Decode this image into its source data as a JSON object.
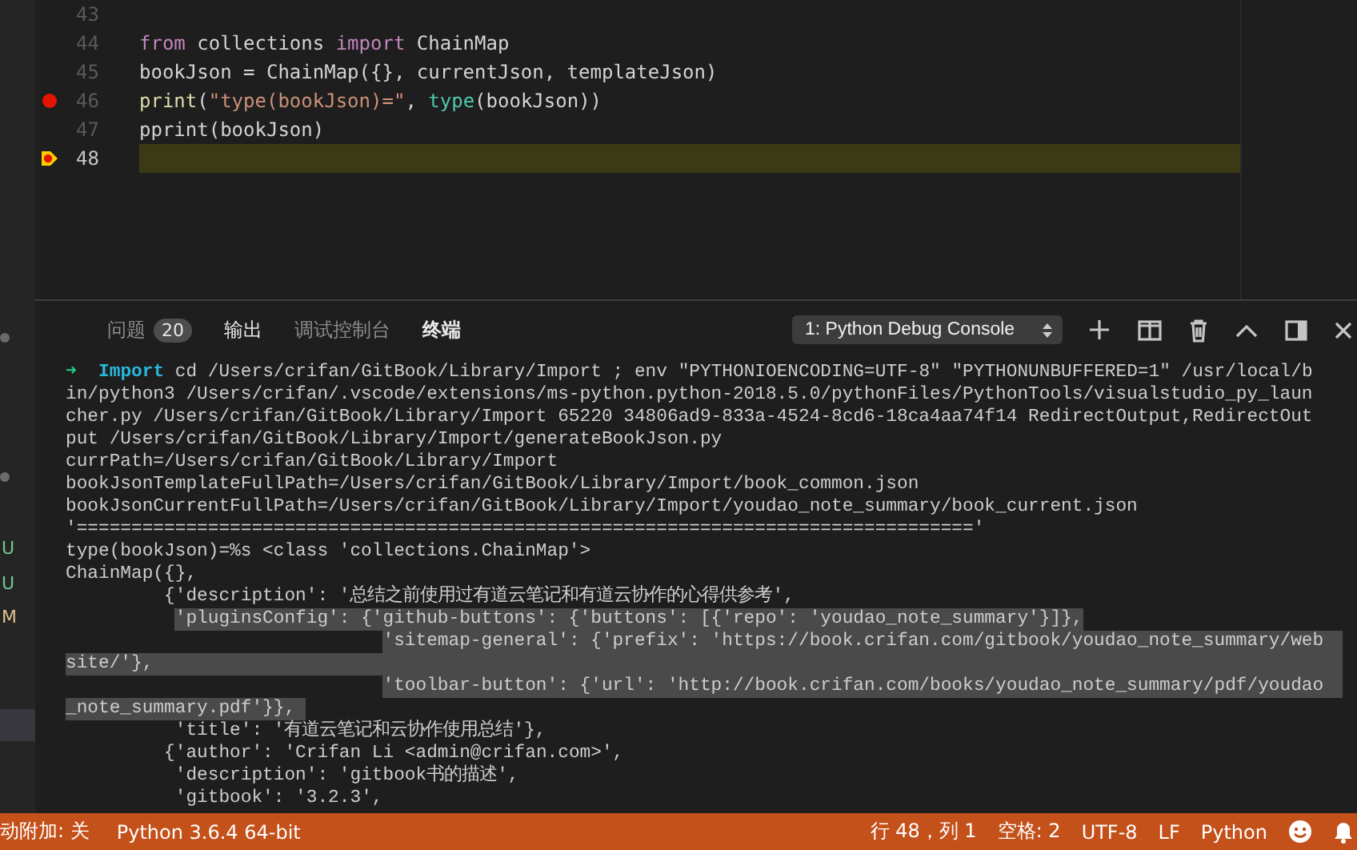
{
  "left_strip": {
    "items": [
      {
        "text": "U",
        "color": "#73c991"
      },
      {
        "text": "U",
        "color": "#73c991"
      },
      {
        "text": "M",
        "color": "#e2c08d"
      }
    ]
  },
  "editor": {
    "lines": [
      {
        "number": "43",
        "breakpoint": false,
        "paused": false,
        "current": false
      },
      {
        "number": "44",
        "breakpoint": false,
        "paused": false,
        "current": false,
        "tokens": [
          {
            "text": "from",
            "kind": "keyword"
          },
          {
            "text": " collections ",
            "kind": "plain"
          },
          {
            "text": "import",
            "kind": "keyword"
          },
          {
            "text": " ChainMap",
            "kind": "plain"
          }
        ]
      },
      {
        "number": "45",
        "breakpoint": false,
        "paused": false,
        "current": false,
        "tokens": [
          {
            "text": "bookJson = ChainMap({}, currentJson, templateJson)",
            "kind": "plain"
          }
        ]
      },
      {
        "number": "46",
        "breakpoint": true,
        "paused": false,
        "current": false,
        "tokens": [
          {
            "text": "print",
            "kind": "function"
          },
          {
            "text": "(",
            "kind": "plain"
          },
          {
            "text": "\"type(bookJson)=\"",
            "kind": "string"
          },
          {
            "text": ", ",
            "kind": "plain"
          },
          {
            "text": "type",
            "kind": "builtin"
          },
          {
            "text": "(bookJson))",
            "kind": "plain"
          }
        ]
      },
      {
        "number": "47",
        "breakpoint": false,
        "paused": false,
        "current": false,
        "tokens": [
          {
            "text": "pprint(bookJson)",
            "kind": "plain"
          }
        ]
      },
      {
        "number": "48",
        "breakpoint": true,
        "paused": true,
        "current": true
      }
    ]
  },
  "panel": {
    "tabs": [
      {
        "label": "问题",
        "badge": "20",
        "selected": false
      },
      {
        "label": "输出",
        "selected": false
      },
      {
        "label": "调试控制台",
        "selected": false
      },
      {
        "label": "终端",
        "selected": true
      }
    ],
    "terminal_select": "1: Python Debug Console",
    "terminal": [
      {
        "selected_to_end": false,
        "segments": [
          {
            "text": "➜",
            "kind": "arrow",
            "selected": false
          },
          {
            "text": "  Import",
            "kind": "dir",
            "selected": false
          },
          {
            "text": " cd /Users/crifan/GitBook/Library/Import ; env \"PYTHONIOENCODING=UTF-8\" \"PYTHONUNBUFFERED=1\" /usr/local/b",
            "kind": "plain",
            "selected": false
          }
        ]
      },
      {
        "selected_to_end": false,
        "segments": [
          {
            "text": "in/python3 /Users/crifan/.vscode/extensions/ms-python.python-2018.5.0/pythonFiles/PythonTools/visualstudio_py_laun",
            "kind": "plain",
            "selected": false
          }
        ]
      },
      {
        "selected_to_end": false,
        "segments": [
          {
            "text": "cher.py /Users/crifan/GitBook/Library/Import 65220 34806ad9-833a-4524-8cd6-18ca4aa74f14 RedirectOutput,RedirectOut",
            "kind": "plain",
            "selected": false
          }
        ]
      },
      {
        "selected_to_end": false,
        "segments": [
          {
            "text": "put /Users/crifan/GitBook/Library/Import/generateBookJson.py",
            "kind": "plain",
            "selected": false
          }
        ]
      },
      {
        "selected_to_end": false,
        "segments": [
          {
            "text": "currPath=/Users/crifan/GitBook/Library/Import",
            "kind": "plain",
            "selected": false
          }
        ]
      },
      {
        "selected_to_end": false,
        "segments": [
          {
            "text": "bookJsonTemplateFullPath=/Users/crifan/GitBook/Library/Import/book_common.json",
            "kind": "plain",
            "selected": false
          }
        ]
      },
      {
        "selected_to_end": false,
        "segments": [
          {
            "text": "bookJsonCurrentFullPath=/Users/crifan/GitBook/Library/Import/youdao_note_summary/book_current.json",
            "kind": "plain",
            "selected": false
          }
        ]
      },
      {
        "selected_to_end": false,
        "segments": [
          {
            "text": "'=================================================================================='",
            "kind": "plain",
            "selected": false
          }
        ]
      },
      {
        "selected_to_end": false,
        "segments": [
          {
            "text": "type(bookJson)=%s <class 'collections.ChainMap'>",
            "kind": "plain",
            "selected": false
          }
        ]
      },
      {
        "selected_to_end": false,
        "segments": [
          {
            "text": "ChainMap({},",
            "kind": "plain",
            "selected": false
          }
        ]
      },
      {
        "selected_to_end": false,
        "segments": [
          {
            "text": "         {'description': '总结之前使用过有道云笔记和有道云协作的心得供参考',",
            "kind": "plain",
            "selected": false
          }
        ]
      },
      {
        "selected_to_end": false,
        "segments": [
          {
            "text": "          'pluginsConfig': {'github-buttons': {'buttons': [{'repo': 'youdao_note_summary'}]},",
            "kind": "plain",
            "selected": true
          }
        ]
      },
      {
        "selected_to_end": true,
        "segments": [
          {
            "text": "                             'sitemap-general': {'prefix': 'https://book.crifan.com/gitbook/youdao_note_summary/web",
            "kind": "plain",
            "selected": true
          }
        ]
      },
      {
        "selected_to_end": true,
        "segments": [
          {
            "text": "site/'},",
            "kind": "plain",
            "selected": true
          }
        ]
      },
      {
        "selected_to_end": true,
        "segments": [
          {
            "text": "                             'toolbar-button': {'url': 'http://book.crifan.com/books/youdao_note_summary/pdf/youdao",
            "kind": "plain",
            "selected": true
          }
        ]
      },
      {
        "selected_to_end": false,
        "segments": [
          {
            "text": "_note_summary.pdf'}}, ",
            "kind": "plain",
            "selected": true
          }
        ]
      },
      {
        "selected_to_end": false,
        "segments": [
          {
            "text": "          'title': '有道云笔记和云协作使用总结'},",
            "kind": "plain",
            "selected": false
          }
        ]
      },
      {
        "selected_to_end": false,
        "segments": [
          {
            "text": "         {'author': 'Crifan Li <admin@crifan.com>',",
            "kind": "plain",
            "selected": false
          }
        ]
      },
      {
        "selected_to_end": false,
        "segments": [
          {
            "text": "          'description': 'gitbook书的描述',",
            "kind": "plain",
            "selected": false
          }
        ]
      },
      {
        "selected_to_end": false,
        "segments": [
          {
            "text": "          'gitbook': '3.2.3',",
            "kind": "plain",
            "selected": false
          }
        ]
      }
    ]
  },
  "status_bar": {
    "left": [
      "动附加: 关",
      "Python 3.6.4 64-bit"
    ],
    "right": [
      "行 48，列 1",
      "空格: 2",
      "UTF-8",
      "LF",
      "Python"
    ]
  }
}
